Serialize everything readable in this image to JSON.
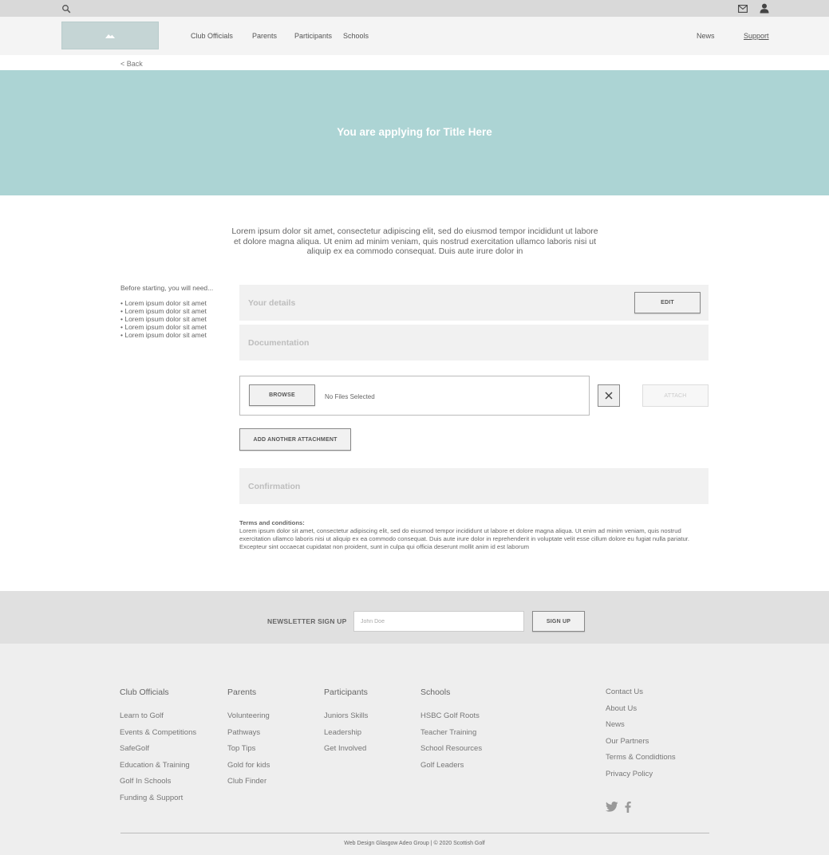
{
  "header": {
    "nav_left": [
      "Club Officials",
      "Parents",
      "Participants",
      "Schools"
    ],
    "nav_right": [
      "News",
      "Support"
    ]
  },
  "back_link": "< Back",
  "hero": {
    "title": "You are applying for Title Here"
  },
  "intro": "Lorem ipsum dolor sit amet, consectetur adipiscing elit, sed do eiusmod tempor incididunt ut labore et dolore magna aliqua. Ut enim ad minim veniam, quis nostrud exercitation ullamco laboris nisi ut aliquip ex ea commodo consequat. Duis aute irure dolor in",
  "before": {
    "title": "Before starting, you will need...",
    "items": [
      "• Lorem ipsum dolor sit amet",
      "• Lorem ipsum dolor sit amet",
      "• Lorem ipsum dolor sit amet",
      "• Lorem ipsum dolor sit amet",
      "• Lorem ipsum dolor sit amet"
    ]
  },
  "sections": {
    "details": "Your details",
    "edit_label": "EDIT",
    "documentation": "Documentation",
    "confirmation": "Confirmation"
  },
  "upload": {
    "browse_label": "BROWSE",
    "status": "No Files Selected",
    "attach_label": "ATTACH",
    "add_another_label": "ADD ANOTHER ATTACHMENT"
  },
  "terms": {
    "title": "Terms and conditions:",
    "body": "Lorem ipsum dolor sit amet, consectetur adipiscing elit, sed do eiusmod tempor incididunt ut labore et dolore magna aliqua. Ut enim ad minim veniam, quis nostrud exercitation ullamco laboris nisi ut aliquip ex ea commodo consequat. Duis aute irure dolor in reprehenderit in voluptate velit esse cillum dolore eu fugiat nulla pariatur. Excepteur sint occaecat cupidatat non proident, sunt in culpa qui officia deserunt mollit anim id est laborum"
  },
  "newsletter": {
    "label": "NEWSLETTER SIGN UP",
    "placeholder": "John Doe",
    "button": "SIGN UP"
  },
  "footer": {
    "columns": [
      {
        "heading": "Club Officials",
        "items": [
          "Learn to Golf",
          "Events & Competitions",
          "SafeGolf",
          "Education & Training",
          "Golf In Schools",
          "Funding & Support"
        ]
      },
      {
        "heading": "Parents",
        "items": [
          "Volunteering",
          "Pathways",
          "Top Tips",
          "Gold for kids",
          "Club Finder"
        ]
      },
      {
        "heading": "Participants",
        "items": [
          "Juniors Skills",
          "Leadership",
          "Get Involved"
        ]
      },
      {
        "heading": "Schools",
        "items": [
          "HSBC Golf Roots",
          "Teacher Training",
          "School Resources",
          "Golf Leaders"
        ]
      }
    ],
    "links": [
      "Contact Us",
      "About Us",
      "News",
      "Our Partners",
      "Terms & Condidtions",
      "Privacy Policy"
    ],
    "copyright": "Web Design Glasgow Adeo Group | © 2020 Scottish Golf"
  },
  "icons": {
    "search": "search-icon",
    "mail": "mail-icon",
    "user": "user-icon",
    "twitter": "twitter-icon",
    "facebook": "facebook-icon",
    "close": "close-icon"
  }
}
